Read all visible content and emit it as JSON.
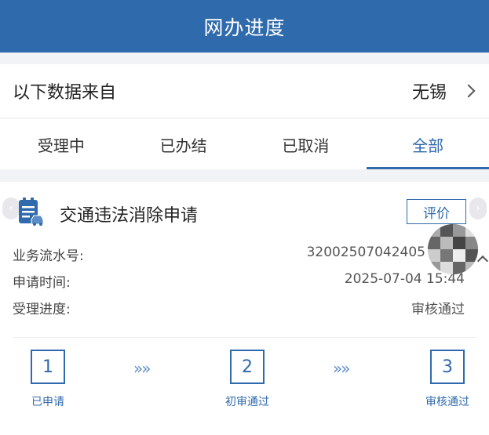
{
  "header": {
    "title": "网办进度"
  },
  "source": {
    "label": "以下数据来自",
    "city": "无锡"
  },
  "tabs": [
    {
      "label": "受理中"
    },
    {
      "label": "已办结"
    },
    {
      "label": "已取消"
    },
    {
      "label": "全部"
    }
  ],
  "active_tab": "全部",
  "card": {
    "title": "交通违法消除申请",
    "rate_button": "评价",
    "fields": [
      {
        "label": "业务流水号:",
        "value": "32002507042405"
      },
      {
        "label": "申请时间:",
        "value": "2025-07-04 15:44"
      },
      {
        "label": "受理进度:",
        "value": "审核通过"
      }
    ],
    "steps": [
      {
        "number": "1",
        "label": "已申请"
      },
      {
        "number": "2",
        "label": "初审通过"
      },
      {
        "number": "3",
        "label": "审核通过"
      }
    ],
    "step_arrow": "»»"
  },
  "colors": {
    "brand": "#2f6aad",
    "background": "#f2f3f7"
  },
  "icons": [
    "chevron-right-icon",
    "document-car-icon",
    "chevron-left-icon",
    "chevron-up-icon"
  ]
}
